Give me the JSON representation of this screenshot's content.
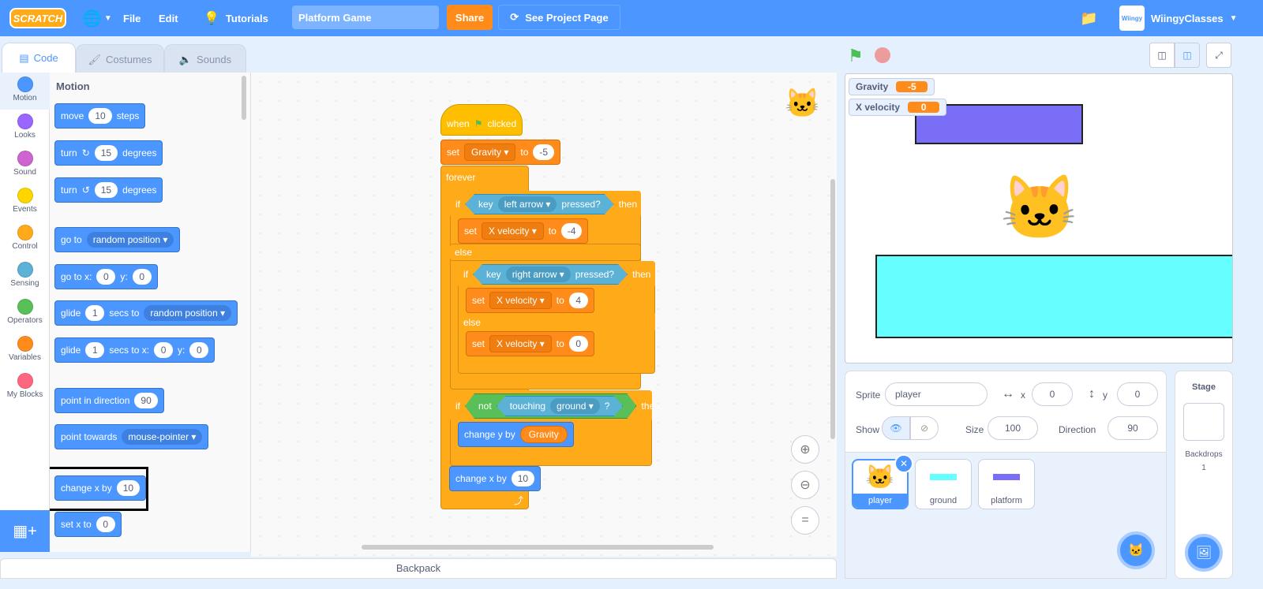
{
  "menubar": {
    "logo": "SCRATCH",
    "file": "File",
    "edit": "Edit",
    "tutorials": "Tutorials",
    "project_title": "Platform Game",
    "share": "Share",
    "see_project": "See Project Page",
    "username": "WiingyClasses",
    "brand_color": "#4c97ff"
  },
  "tabs": [
    {
      "label": "Code"
    },
    {
      "label": "Costumes"
    },
    {
      "label": "Sounds"
    }
  ],
  "categories": [
    {
      "label": "Motion",
      "color": "#4c97ff"
    },
    {
      "label": "Looks",
      "color": "#9966ff"
    },
    {
      "label": "Sound",
      "color": "#cf63cf"
    },
    {
      "label": "Events",
      "color": "#ffd500"
    },
    {
      "label": "Control",
      "color": "#ffab19"
    },
    {
      "label": "Sensing",
      "color": "#5cb1d6"
    },
    {
      "label": "Operators",
      "color": "#59c059"
    },
    {
      "label": "Variables",
      "color": "#ff8c1a"
    },
    {
      "label": "My Blocks",
      "color": "#ff6680"
    }
  ],
  "palette": {
    "heading": "Motion",
    "move": {
      "a": "move",
      "n": "10",
      "b": "steps"
    },
    "turn_cw": {
      "a": "turn",
      "n": "15",
      "b": "degrees"
    },
    "turn_ccw": {
      "a": "turn",
      "n": "15",
      "b": "degrees"
    },
    "goto": {
      "a": "go to",
      "d": "random position"
    },
    "gotoxy": {
      "a": "go to x:",
      "x": "0",
      "b": "y:",
      "y": "0"
    },
    "glide": {
      "a": "glide",
      "n": "1",
      "b": "secs to",
      "d": "random position"
    },
    "glidexy": {
      "a": "glide",
      "n": "1",
      "b": "secs to x:",
      "x": "0",
      "c": "y:",
      "y": "0"
    },
    "point": {
      "a": "point in direction",
      "n": "90"
    },
    "towards": {
      "a": "point towards",
      "d": "mouse-pointer"
    },
    "changex": {
      "a": "change x by",
      "n": "10"
    },
    "setx": {
      "a": "set x to",
      "n": "0"
    }
  },
  "script": {
    "hat": {
      "a": "when",
      "b": "clicked"
    },
    "set_gravity": {
      "a": "set",
      "v": "Gravity",
      "b": "to",
      "n": "-5"
    },
    "forever": "forever",
    "if1": {
      "a": "if",
      "key": "key",
      "opt": "left arrow",
      "p": "pressed?",
      "then": "then"
    },
    "set_xv1": {
      "a": "set",
      "v": "X velocity",
      "b": "to",
      "n": "-4"
    },
    "else1": "else",
    "if2": {
      "a": "if",
      "key": "key",
      "opt": "right arrow",
      "p": "pressed?",
      "then": "then"
    },
    "set_xv2": {
      "a": "set",
      "v": "X velocity",
      "b": "to",
      "n": "4"
    },
    "else2": "else",
    "set_xv3": {
      "a": "set",
      "v": "X velocity",
      "b": "to",
      "n": "0"
    },
    "if3": {
      "a": "if",
      "not": "not",
      "touching": "touching",
      "opt": "ground",
      "q": "?",
      "then": "then"
    },
    "changey": {
      "a": "change y by",
      "r": "Gravity"
    },
    "changex": {
      "a": "change x by",
      "n": "10"
    }
  },
  "backpack": "Backpack",
  "monitors": [
    {
      "name": "Gravity",
      "value": "-5"
    },
    {
      "name": "X velocity",
      "value": "0"
    }
  ],
  "sprite_info": {
    "sprite_label": "Sprite",
    "sprite_name": "player",
    "x_label": "x",
    "x": "0",
    "y_label": "y",
    "y": "0",
    "show_label": "Show",
    "size_label": "Size",
    "size": "100",
    "direction_label": "Direction",
    "direction": "90"
  },
  "sprites": [
    {
      "name": "player",
      "selected": true
    },
    {
      "name": "ground"
    },
    {
      "name": "platform"
    }
  ],
  "stage_pane": {
    "title": "Stage",
    "backdrops_label": "Backdrops",
    "backdrops": "1"
  }
}
